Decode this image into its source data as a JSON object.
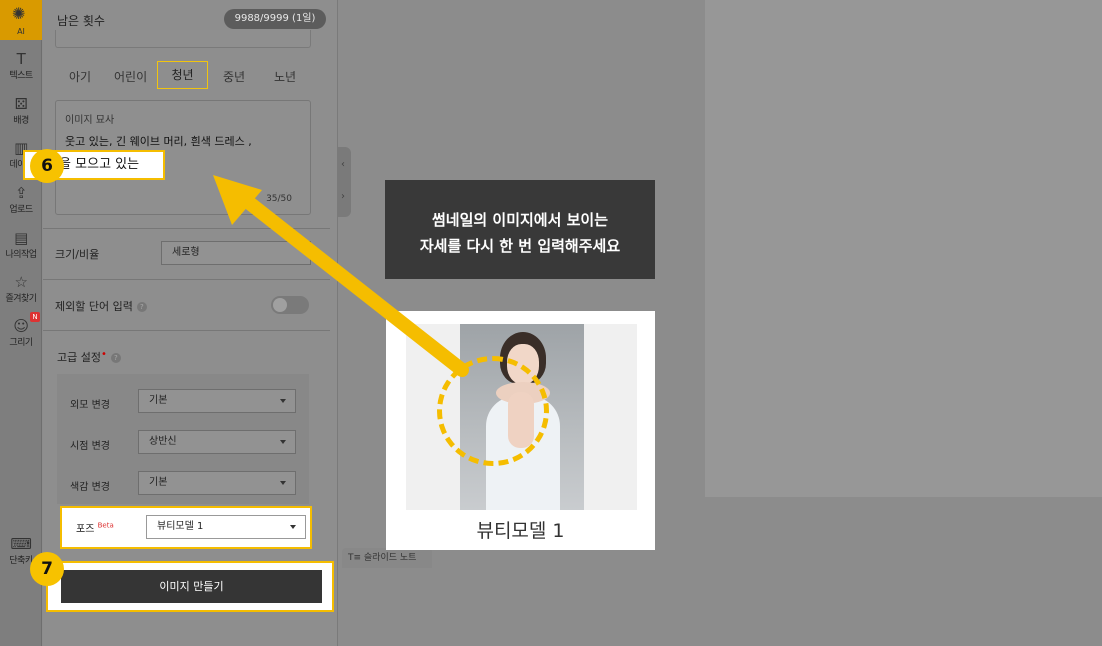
{
  "rail": {
    "ai": "AI",
    "items": [
      {
        "label": "텍스트",
        "icon": "text-icon"
      },
      {
        "label": "배경",
        "icon": "background-icon"
      },
      {
        "label": "데이터",
        "icon": "chart-icon"
      },
      {
        "label": "업로드",
        "icon": "upload-icon"
      },
      {
        "label": "나의작업",
        "icon": "folder-icon"
      },
      {
        "label": "즐겨찾기",
        "icon": "star-icon"
      },
      {
        "label": "그리기",
        "icon": "draw-icon"
      }
    ],
    "new_badge": "N",
    "shortcut": "단축키"
  },
  "panel": {
    "remaining_label": "남은 횟수",
    "remaining_count": "9988/9999 (1일)",
    "ages": [
      "아기",
      "어린이",
      "청년",
      "중년",
      "노년"
    ],
    "selected_age": "청년",
    "description": {
      "title": "이미지 묘사",
      "line1": "웃고 있는, 긴 웨이브 머리, 흰색 드레스 ,",
      "line2": "두 손을 모으고 있는",
      "count": "35/50"
    },
    "size_label": "크기/비율",
    "size_value": "세로형",
    "exclude_label": "제외할 단어 입력",
    "advanced_label": "고급 설정",
    "advanced_mark": "•",
    "appearance_label": "외모 변경",
    "appearance_value": "기본",
    "viewpoint_label": "시점 변경",
    "viewpoint_value": "상반신",
    "tone_label": "색감 변경",
    "tone_value": "기본",
    "pose_label": "포즈",
    "pose_beta": "Beta",
    "pose_value": "뷰티모델 1",
    "make_button": "이미지 만들기",
    "help": "?"
  },
  "steps": {
    "six": "6",
    "seven": "7"
  },
  "slide_note": "슬라이드 노트",
  "callout": {
    "line1": "썸네일의 이미지에서 보이는",
    "line2": "자세를 다시 한 번 입력해주세요"
  },
  "thumbnail": {
    "name": "뷰티모델 1"
  },
  "colors": {
    "highlight": "#f5bd00",
    "callout_bg": "#393939",
    "button_bg": "#353535"
  }
}
